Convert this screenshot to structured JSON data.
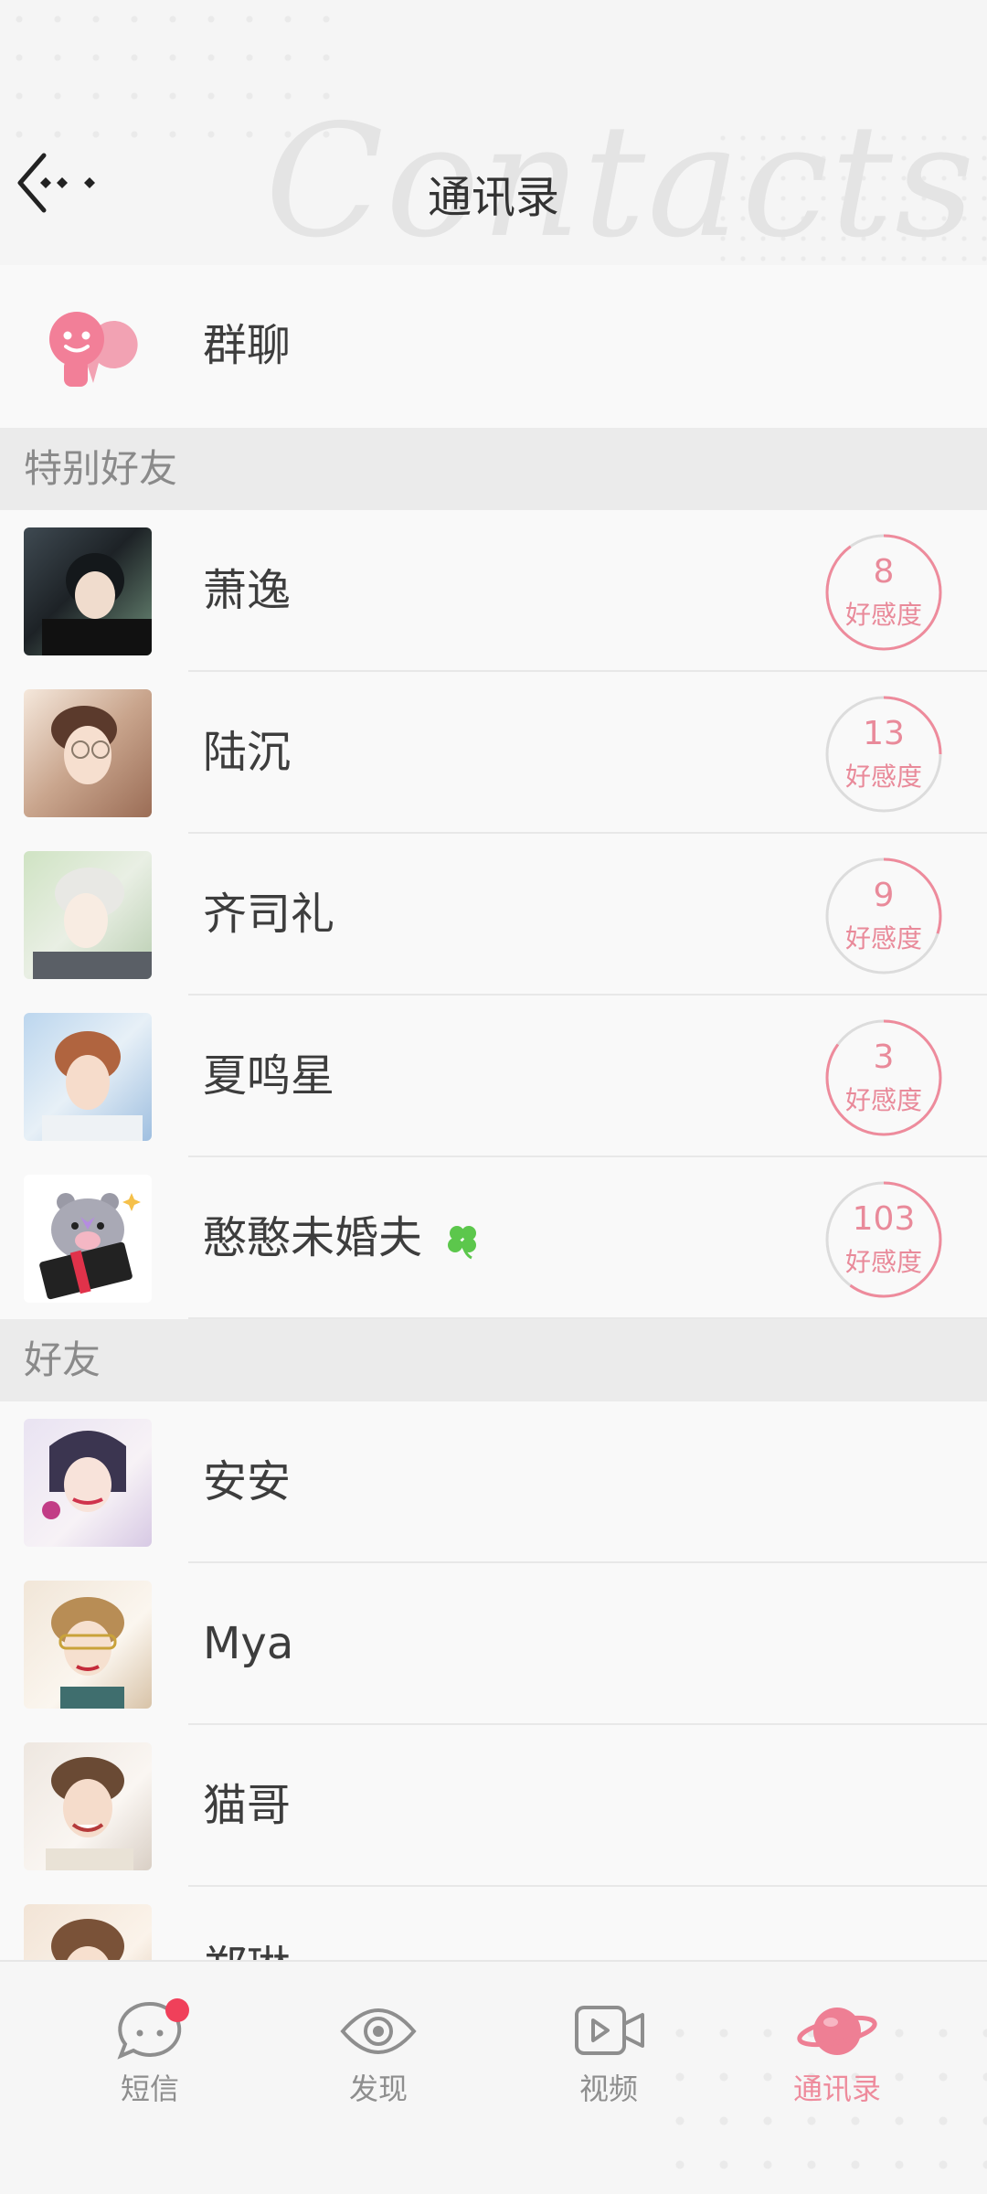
{
  "header": {
    "title": "通讯录",
    "watermark": "Contacts"
  },
  "group_chat": {
    "label": "群聊"
  },
  "sections": {
    "special": "特别好友",
    "friends": "好友"
  },
  "special_friends": [
    {
      "name": "萧逸",
      "affinity": "8",
      "affinity_label": "好感度",
      "progress": 0.9
    },
    {
      "name": "陆沉",
      "affinity": "13",
      "affinity_label": "好感度",
      "progress": 0.25
    },
    {
      "name": "齐司礼",
      "affinity": "9",
      "affinity_label": "好感度",
      "progress": 0.3
    },
    {
      "name": "夏鸣星",
      "affinity": "3",
      "affinity_label": "好感度",
      "progress": 0.85
    },
    {
      "name": "憨憨未婚夫",
      "affinity": "103",
      "affinity_label": "好感度",
      "progress": 0.6
    }
  ],
  "friends": [
    {
      "name": "安安"
    },
    {
      "name": "Mya"
    },
    {
      "name": "猫哥"
    },
    {
      "name": "郑琳"
    }
  ],
  "nav": [
    {
      "label": "短信",
      "icon": "chat-bubble-icon",
      "badge": true
    },
    {
      "label": "发现",
      "icon": "eye-icon"
    },
    {
      "label": "视频",
      "icon": "video-icon"
    },
    {
      "label": "通讯录",
      "icon": "planet-icon",
      "active": true
    }
  ],
  "colors": {
    "accent": "#ee8b9c",
    "badge": "#f0405a",
    "leaf": "#5cc74c"
  }
}
